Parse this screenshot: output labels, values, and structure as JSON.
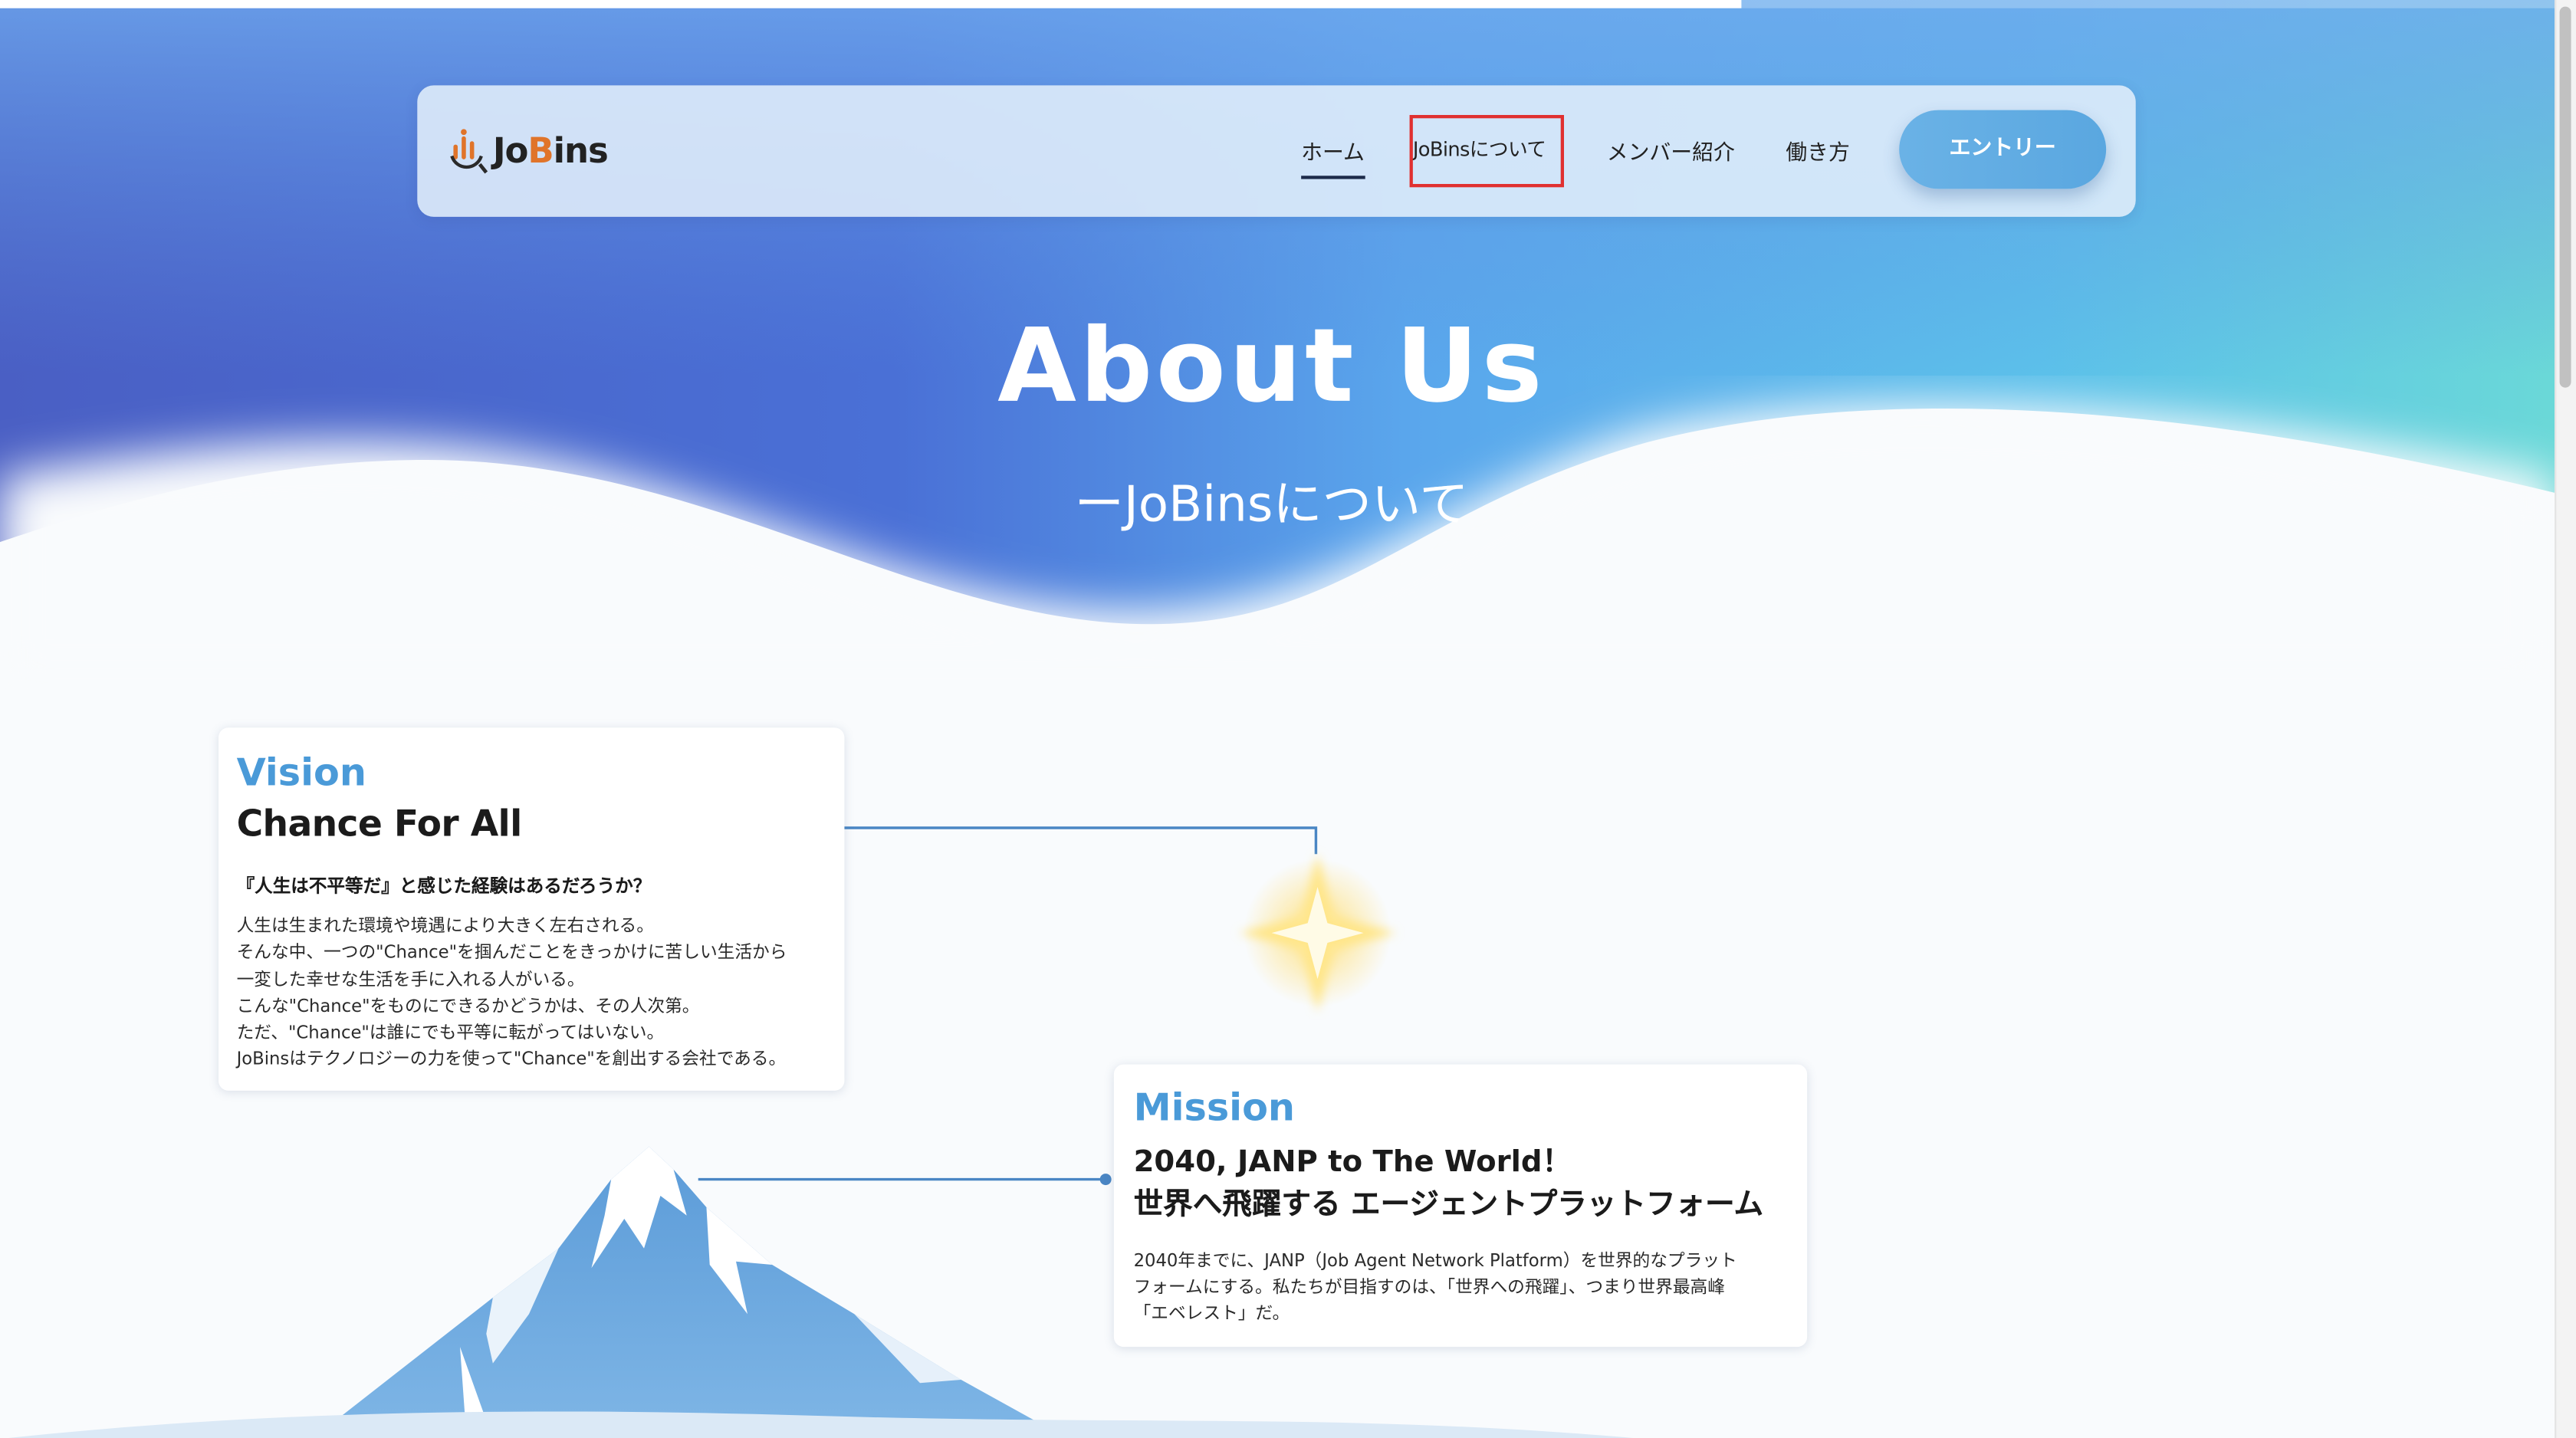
{
  "nav": {
    "logo_text_prefix": "Jo",
    "logo_text_b": "B",
    "logo_text_suffix": "ins",
    "items": [
      {
        "label": "ホーム"
      },
      {
        "label": "JoBinsについて"
      },
      {
        "label": "メンバー紹介"
      },
      {
        "label": "働き方"
      }
    ],
    "entry_button": "エントリー"
  },
  "hero": {
    "title": "About Us",
    "subtitle": "ーJoBinsについて"
  },
  "vision": {
    "kicker": "Vision",
    "title": "Chance For All",
    "lead": "『人生は不平等だ』と感じた経験はあるだろうか？",
    "body": [
      "人生は生まれた環境や境遇により大きく左右される。",
      "そんな中、一つの\"Chance\"を掴んだことをきっかけに苦しい生活から",
      "一変した幸せな生活を手に入れる人がいる。",
      "こんな\"Chance\"をものにできるかどうかは、その人次第。",
      "ただ、\"Chance\"は誰にでも平等に転がってはいない。",
      "JoBinsはテクノロジーの力を使って\"Chance\"を創出する会社である。"
    ]
  },
  "mission": {
    "kicker": "Mission",
    "title_line1": "2040, JANP to The World！",
    "title_line2": "世界へ飛躍する エージェントプラットフォーム",
    "body": [
      "2040年までに、JANP（Job Agent Network Platform）を世界的なプラット",
      "フォームにする。私たちが目指すのは、「世界への飛躍」、つまり世界最高峰",
      "「エベレスト」だ。"
    ]
  },
  "colors": {
    "accent_blue": "#4a9ad8",
    "hero_deep": "#3f55bf",
    "hero_light": "#5fb2ec",
    "highlight_box": "#e03030"
  },
  "icons": [
    "jobins-logo-icon",
    "sparkle-icon",
    "mountain-illustration"
  ]
}
